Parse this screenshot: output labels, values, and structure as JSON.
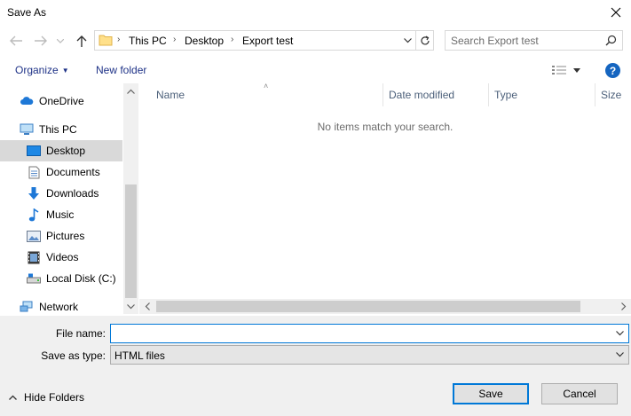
{
  "window": {
    "title": "Save As"
  },
  "address": {
    "crumbs": [
      "This PC",
      "Desktop",
      "Export test"
    ]
  },
  "search": {
    "placeholder": "Search Export test"
  },
  "toolbar": {
    "organize_label": "Organize",
    "new_folder_label": "New folder"
  },
  "sidebar": {
    "items": [
      {
        "label": "OneDrive",
        "icon": "cloud-icon"
      },
      {
        "label": "This PC",
        "icon": "computer-icon"
      },
      {
        "label": "Desktop",
        "icon": "desktop-icon",
        "selected": true
      },
      {
        "label": "Documents",
        "icon": "documents-icon"
      },
      {
        "label": "Downloads",
        "icon": "download-icon"
      },
      {
        "label": "Music",
        "icon": "music-icon"
      },
      {
        "label": "Pictures",
        "icon": "pictures-icon"
      },
      {
        "label": "Videos",
        "icon": "videos-icon"
      },
      {
        "label": "Local Disk (C:)",
        "icon": "drive-icon"
      },
      {
        "label": "Network",
        "icon": "network-icon"
      }
    ]
  },
  "filelist": {
    "columns": [
      "Name",
      "Date modified",
      "Type",
      "Size"
    ],
    "empty_message": "No items match your search."
  },
  "form": {
    "filename_label": "File name:",
    "filename_value": "",
    "filetype_label": "Save as type:",
    "filetype_value": "HTML files"
  },
  "footer": {
    "hide_folders_label": "Hide Folders",
    "save_label": "Save",
    "cancel_label": "Cancel"
  },
  "colors": {
    "accent": "#0078d7",
    "link": "#1e3287",
    "help": "#1565c0"
  }
}
